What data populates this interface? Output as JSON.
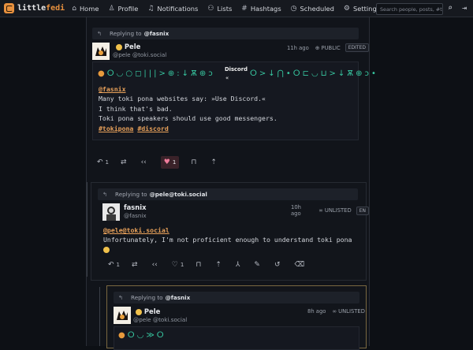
{
  "app": {
    "name_a": "little",
    "name_b": "fedi"
  },
  "nav": [
    {
      "label": "Home",
      "icon": "home-icon",
      "glyph": "⌂"
    },
    {
      "label": "Profile",
      "icon": "user-icon",
      "glyph": "⚇"
    },
    {
      "label": "Notifications",
      "icon": "bell-icon",
      "glyph": "♫"
    },
    {
      "label": "Lists",
      "icon": "users-icon",
      "glyph": "⚇"
    },
    {
      "label": "Hashtags",
      "icon": "hash-icon",
      "glyph": "#"
    },
    {
      "label": "Scheduled",
      "icon": "clock-icon",
      "glyph": "◷"
    },
    {
      "label": "Settings",
      "icon": "gear-icon",
      "glyph": "⚙"
    }
  ],
  "search": {
    "placeholder": "Search people, posts, #tags"
  },
  "posts": [
    {
      "reply_prefix": "Replying to",
      "reply_to": "@fasnix",
      "author": "Pele",
      "handle": "@pele @toki.social",
      "time": "11h ago",
      "visibility": "PUBLIC",
      "badge": "EDITED",
      "glyph_row": "ⵔ◡○◻|||>⊕:↓Ѫ⊕ↄ",
      "glyph_label": "Discord",
      "glyph_sub": "«",
      "glyph_row2": "ⵔ>↓⋂•ⵔ⊏◡⊔>↓Ѫ⊕ↄ•",
      "mention": "@fasnix",
      "lines": [
        "Many toki pona websites say: »Use Discord.«",
        "I think that's bad.",
        "Toki pona speakers should use good messengers."
      ],
      "tags": [
        "#tokipona",
        "#discord"
      ],
      "replies": "1",
      "likes": "1"
    },
    {
      "reply_prefix": "Replying to",
      "reply_to": "@pele@toki.social",
      "author": "fasnix",
      "handle": "@fasnix",
      "time": "10h ago",
      "visibility": "UNLISTED",
      "badge": "EN",
      "mention": "@pele@toki.social",
      "text": "Unfortunately, I'm not proficient enough to understand toki pona",
      "replies": "1",
      "likes": "1"
    },
    {
      "reply_prefix": "Replying to",
      "reply_to": "@fasnix",
      "author": "Pele",
      "handle": "@pele @toki.social",
      "time": "8h ago",
      "visibility": "UNLISTED",
      "glyph_row": "ⵔ◡≫ⵔ"
    }
  ],
  "colors": {
    "accent": "#e8913e",
    "glyph": "#37c7a0",
    "like": "#f17c9c"
  }
}
